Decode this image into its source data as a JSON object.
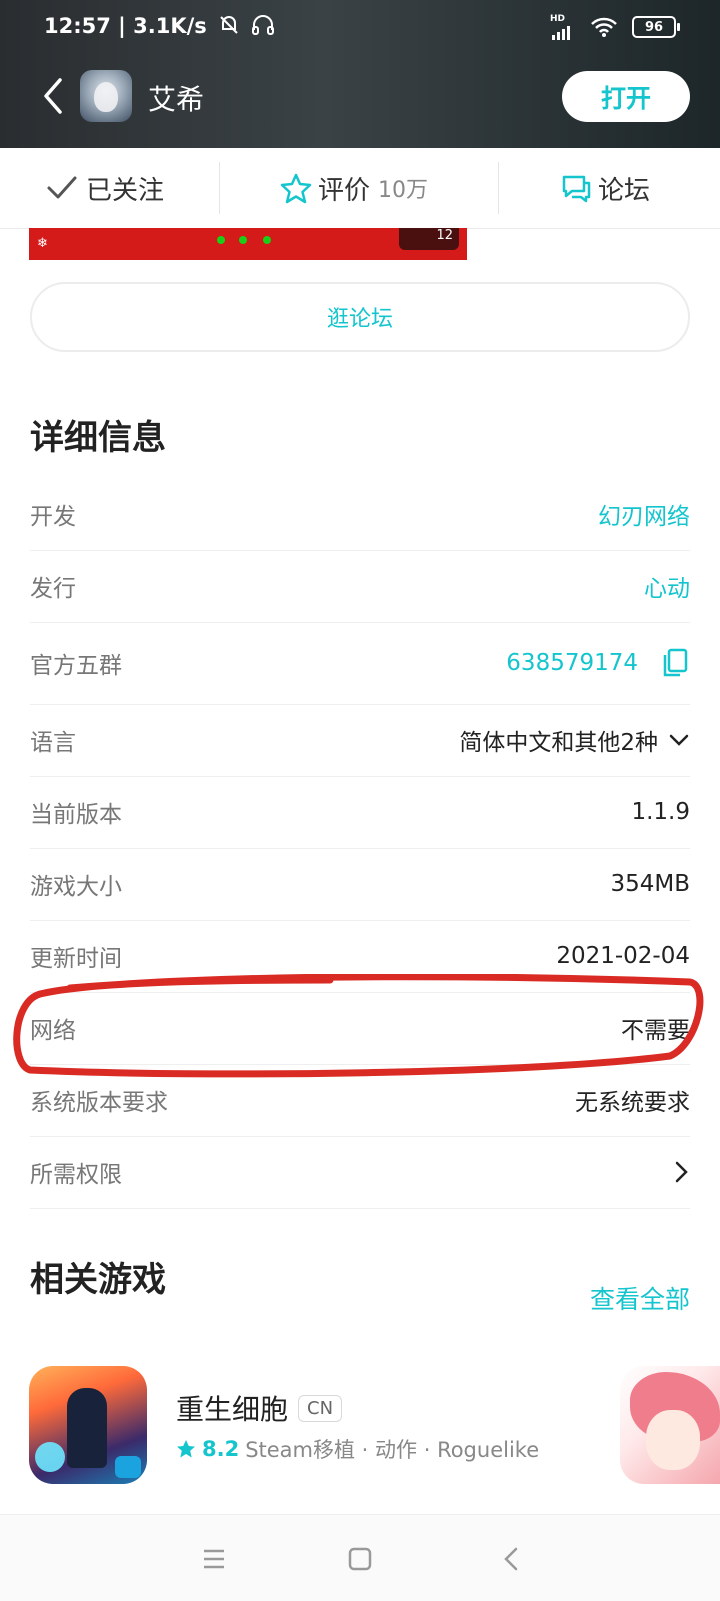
{
  "status_bar": {
    "time": "12:57",
    "net_speed": "3.1K/s",
    "battery": "96",
    "hd_label": "HD"
  },
  "header": {
    "title": "艾希",
    "open_button": "打开"
  },
  "tabs": {
    "follow": "已关注",
    "rating_label": "评价",
    "rating_count": "10万",
    "forum": "论坛"
  },
  "banner": {
    "badge": "12"
  },
  "forum_button": "逛论坛",
  "details": {
    "title": "详细信息",
    "rows": [
      {
        "label": "开发",
        "value": "幻刃网络"
      },
      {
        "label": "发行",
        "value": "心动"
      },
      {
        "label": "官方五群",
        "value": "638579174"
      },
      {
        "label": "语言",
        "value": "简体中文和其他2种"
      },
      {
        "label": "当前版本",
        "value": "1.1.9"
      },
      {
        "label": "游戏大小",
        "value": "354MB"
      },
      {
        "label": "更新时间",
        "value": "2021-02-04"
      },
      {
        "label": "网络",
        "value": "不需要"
      },
      {
        "label": "系统版本要求",
        "value": "无系统要求"
      },
      {
        "label": "所需权限",
        "value": ""
      }
    ]
  },
  "related": {
    "title": "相关游戏",
    "see_all": "查看全部",
    "games": [
      {
        "name": "重生细胞",
        "badge": "CN",
        "score": "8.2",
        "tags": "Steam移植 · 动作 · Roguelike"
      }
    ]
  },
  "colors": {
    "accent": "#15c5ce",
    "annotation": "#d92b24"
  },
  "icons": [
    "back-arrow-icon",
    "checkmark-icon",
    "star-icon",
    "chat-icon",
    "copy-icon",
    "chevron-down-icon",
    "chevron-right-icon",
    "menu-icon",
    "home-icon",
    "nav-back-icon"
  ]
}
